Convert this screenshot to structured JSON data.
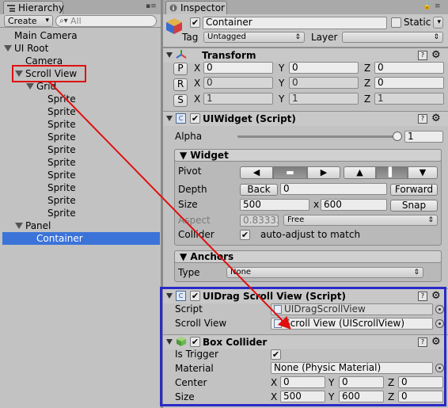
{
  "hierarchy": {
    "tab_label": "Hierarchy",
    "create_label": "Create",
    "search_placeholder": "All",
    "items": [
      {
        "label": "Main Camera"
      },
      {
        "label": "UI Root"
      },
      {
        "label": "Camera"
      },
      {
        "label": "Scroll View"
      },
      {
        "label": "Grid"
      },
      {
        "label": "Sprite"
      },
      {
        "label": "Sprite"
      },
      {
        "label": "Sprite"
      },
      {
        "label": "Sprite"
      },
      {
        "label": "Sprite"
      },
      {
        "label": "Sprite"
      },
      {
        "label": "Sprite"
      },
      {
        "label": "Sprite"
      },
      {
        "label": "Sprite"
      },
      {
        "label": "Sprite"
      },
      {
        "label": "Panel"
      },
      {
        "label": "Container"
      }
    ]
  },
  "inspector": {
    "tab_label": "Inspector",
    "object_name": "Container",
    "static_label": "Static",
    "tag_label": "Tag",
    "tag_value": "Untagged",
    "layer_label": "Layer",
    "layer_value": "",
    "transform": {
      "title": "Transform",
      "rows": [
        {
          "btn": "P",
          "x": "0",
          "y": "0",
          "z": "0"
        },
        {
          "btn": "R",
          "x": "0",
          "y": "0",
          "z": "0"
        },
        {
          "btn": "S",
          "x": "1",
          "y": "1",
          "z": "1"
        }
      ],
      "x_label": "X",
      "y_label": "Y",
      "z_label": "Z"
    },
    "uiwidget": {
      "title": "UIWidget (Script)",
      "alpha_label": "Alpha",
      "alpha_value": "1",
      "widget_section": "Widget",
      "pivot_label": "Pivot",
      "pivot_h": [
        "◀",
        "▬",
        "▶"
      ],
      "pivot_v": [
        "▲",
        "▌",
        "▼"
      ],
      "depth_label": "Depth",
      "back_label": "Back",
      "depth_value": "0",
      "forward_label": "Forward",
      "size_label": "Size",
      "size_w": "500",
      "size_x": "x",
      "size_h": "600",
      "snap_label": "Snap",
      "aspect_label": "Aspect",
      "aspect_value": "0.83333",
      "aspect_mode": "Free",
      "collider_label": "Collider",
      "collider_text": "auto-adjust to match",
      "anchors_section": "Anchors",
      "type_label": "Type",
      "type_value": "None"
    },
    "uidrag": {
      "title": "UIDrag Scroll View (Script)",
      "script_label": "Script",
      "script_value": "UIDragScrollView",
      "scrollview_label": "Scroll View",
      "scrollview_value": "Scroll View (UIScrollView)"
    },
    "boxcollider": {
      "title": "Box Collider",
      "trigger_label": "Is Trigger",
      "material_label": "Material",
      "material_value": "None (Physic Material)",
      "center_label": "Center",
      "center": {
        "x": "0",
        "y": "0",
        "z": "0"
      },
      "size_label": "Size",
      "size": {
        "x": "500",
        "y": "600",
        "z": "0"
      }
    }
  },
  "colors": {
    "selection": "#3b73d9",
    "annotation_red": "#e01010",
    "annotation_blue": "#2a2ac8"
  }
}
